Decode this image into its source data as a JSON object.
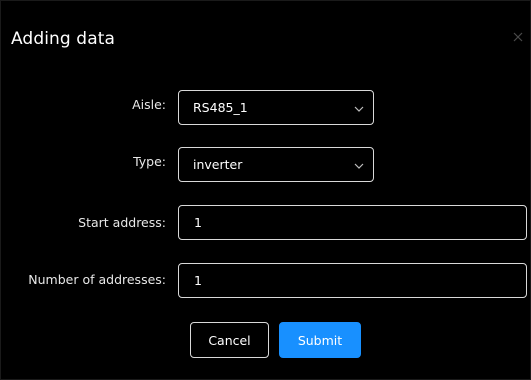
{
  "dialog": {
    "title": "Adding data"
  },
  "form": {
    "aisle": {
      "label": "Aisle:",
      "value": "RS485_1"
    },
    "type": {
      "label": "Type:",
      "value": "inverter"
    },
    "start_address": {
      "label": "Start address:",
      "value": "1"
    },
    "number_of_addresses": {
      "label": "Number of addresses:",
      "value": "1"
    }
  },
  "buttons": {
    "cancel_label": "Cancel",
    "submit_label": "Submit"
  },
  "icons": {
    "close": "close-icon",
    "dropdown": "chevron-down-icon"
  },
  "colors": {
    "background": "#000000",
    "border": "#d9d9d9",
    "accent": "#1890ff",
    "text": "#ffffff"
  }
}
